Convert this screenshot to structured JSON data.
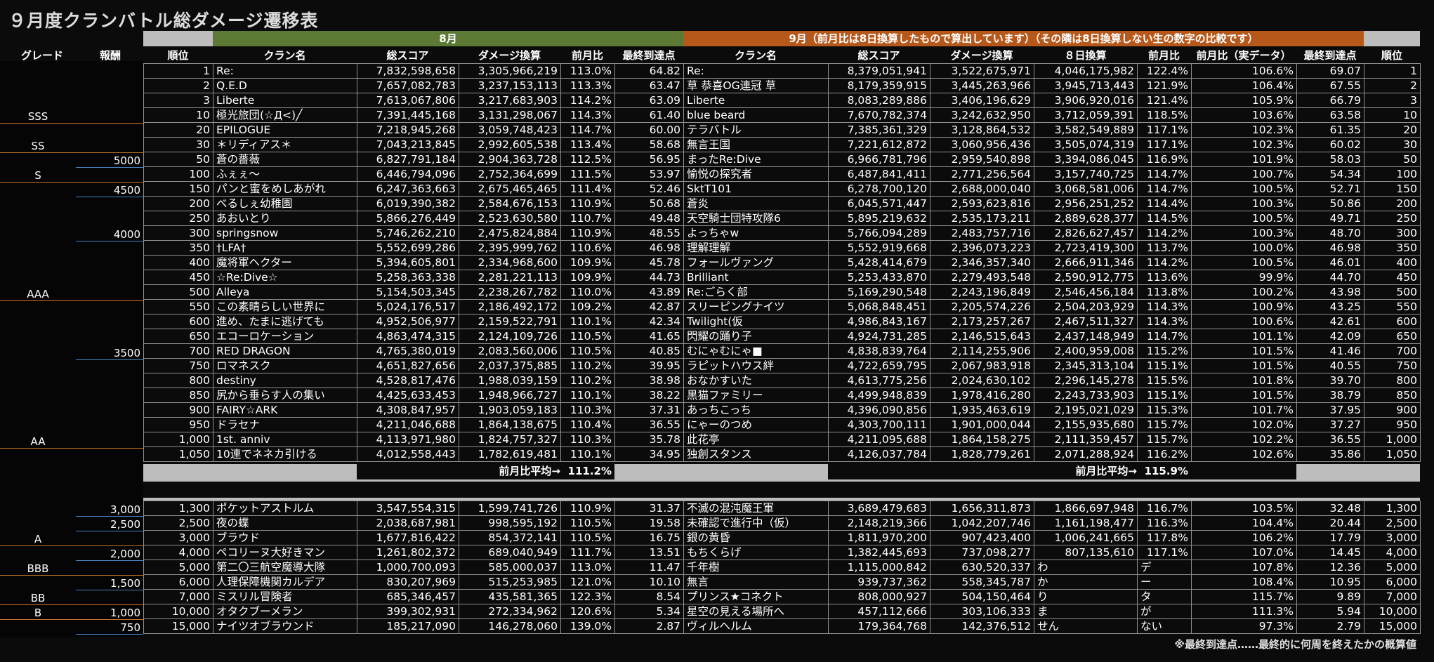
{
  "title": "９月度クランバトル総ダメージ遷移表",
  "headers": {
    "aug_band": "8月",
    "sep_band": "9月（前月比は8日換算したもので算出しています）（その隣は8日換算しない生の数字の比較です）",
    "grade": "グレード",
    "reward": "報酬",
    "rank": "順位",
    "clan": "クラン名",
    "total": "総スコア",
    "dmg": "ダメージ換算",
    "mom": "前月比",
    "final": "最終到達点",
    "clan2": "クラン名",
    "total2": "総スコア",
    "dmg2": "ダメージ換算",
    "eight": "８日換算",
    "mom2": "前月比",
    "momreal": "前月比（実データ）",
    "final2": "最終到達点",
    "rank2": "順位"
  },
  "avg": {
    "aug_label": "前月比平均→",
    "aug_value": "111.2%",
    "sep_label": "前月比平均→",
    "sep_value": "115.9%"
  },
  "grades": [
    {
      "label": "SSS"
    },
    {
      "label": "SS"
    },
    {
      "label": "S"
    },
    {
      "label": "AAA"
    },
    {
      "label": "AA"
    },
    {
      "label": "A"
    },
    {
      "label": "BBB"
    },
    {
      "label": "BB"
    },
    {
      "label": "B"
    }
  ],
  "rewards": [
    {
      "label": "5000"
    },
    {
      "label": "4500"
    },
    {
      "label": "4000"
    },
    {
      "label": "3500"
    },
    {
      "label": "3,000"
    },
    {
      "label": "2,500"
    },
    {
      "label": "2,000"
    },
    {
      "label": "1,500"
    },
    {
      "label": "1,000"
    },
    {
      "label": "750"
    }
  ],
  "rows_top": [
    [
      "1",
      "Re:",
      "7,832,598,658",
      "3,305,966,219",
      "113.0%",
      "64.82",
      "Re:",
      "8,379,051,941",
      "3,522,675,971",
      "4,046,175,982",
      "122.4%",
      "106.6%",
      "69.07",
      "1"
    ],
    [
      "2",
      "Q.E.D",
      "7,657,082,783",
      "3,237,153,113",
      "113.3%",
      "63.47",
      "草 恭喜OG連冠 草",
      "8,179,359,915",
      "3,445,263,966",
      "3,945,713,443",
      "121.9%",
      "106.4%",
      "67.55",
      "2"
    ],
    [
      "3",
      "Liberte",
      "7,613,067,806",
      "3,217,683,903",
      "114.2%",
      "63.09",
      "Liberte",
      "8,083,289,886",
      "3,406,196,629",
      "3,906,920,016",
      "121.4%",
      "105.9%",
      "66.79",
      "3"
    ],
    [
      "10",
      "極光旅団(☆Д<)╱",
      "7,391,445,168",
      "3,131,298,067",
      "114.3%",
      "61.40",
      "blue beard",
      "7,670,782,374",
      "3,242,632,950",
      "3,712,059,391",
      "118.5%",
      "103.6%",
      "63.58",
      "10"
    ],
    [
      "20",
      "EPILOGUE",
      "7,218,945,268",
      "3,059,748,423",
      "114.7%",
      "60.00",
      "テラバトル",
      "7,385,361,329",
      "3,128,864,532",
      "3,582,549,889",
      "117.1%",
      "102.3%",
      "61.35",
      "20"
    ],
    [
      "30",
      "＊リディアス＊",
      "7,043,213,845",
      "2,992,605,538",
      "113.4%",
      "58.68",
      "無言王国",
      "7,221,612,872",
      "3,060,956,436",
      "3,505,074,319",
      "117.1%",
      "102.3%",
      "60.02",
      "30"
    ],
    [
      "50",
      "蒼の薔薇",
      "6,827,791,184",
      "2,904,363,728",
      "112.5%",
      "56.95",
      "まったRe:Dive",
      "6,966,781,796",
      "2,959,540,898",
      "3,394,086,045",
      "116.9%",
      "101.9%",
      "58.03",
      "50"
    ],
    [
      "100",
      "ふぇぇ～",
      "6,446,794,096",
      "2,752,364,699",
      "111.5%",
      "53.97",
      "愉悦の探究者",
      "6,487,841,411",
      "2,771,256,564",
      "3,157,740,725",
      "114.7%",
      "100.7%",
      "54.34",
      "100"
    ],
    [
      "150",
      "パンと蜜をめしあがれ",
      "6,247,363,663",
      "2,675,465,465",
      "111.4%",
      "52.46",
      "SktT101",
      "6,278,700,120",
      "2,688,000,040",
      "3,068,581,006",
      "114.7%",
      "100.5%",
      "52.71",
      "150"
    ],
    [
      "200",
      "べるしぇ幼稚園",
      "6,019,390,382",
      "2,584,676,153",
      "110.9%",
      "50.68",
      "蒼炎",
      "6,045,571,447",
      "2,593,623,816",
      "2,956,251,252",
      "114.4%",
      "100.3%",
      "50.86",
      "200"
    ],
    [
      "250",
      "あおいとり",
      "5,866,276,449",
      "2,523,630,580",
      "110.7%",
      "49.48",
      "天空騎士団特攻隊6",
      "5,895,219,632",
      "2,535,173,211",
      "2,889,628,377",
      "114.5%",
      "100.5%",
      "49.71",
      "250"
    ],
    [
      "300",
      "springsnow",
      "5,746,262,210",
      "2,475,824,884",
      "110.9%",
      "48.55",
      "よっちゃw",
      "5,766,094,289",
      "2,483,757,716",
      "2,826,627,457",
      "114.2%",
      "100.3%",
      "48.70",
      "300"
    ],
    [
      "350",
      "†LFA†",
      "5,552,699,286",
      "2,395,999,762",
      "110.6%",
      "46.98",
      "理解理解",
      "5,552,919,668",
      "2,396,073,223",
      "2,723,419,300",
      "113.7%",
      "100.0%",
      "46.98",
      "350"
    ],
    [
      "400",
      "魔将軍ヘクター",
      "5,394,605,801",
      "2,334,968,600",
      "109.9%",
      "45.78",
      "フォールヴァング",
      "5,428,414,679",
      "2,346,357,340",
      "2,666,911,346",
      "114.2%",
      "100.5%",
      "46.01",
      "400"
    ],
    [
      "450",
      "☆Re:Dive☆",
      "5,258,363,338",
      "2,281,221,113",
      "109.9%",
      "44.73",
      "Brilliant",
      "5,253,433,870",
      "2,279,493,548",
      "2,590,912,775",
      "113.6%",
      "99.9%",
      "44.70",
      "450"
    ],
    [
      "500",
      "Alleya",
      "5,154,503,345",
      "2,238,267,782",
      "110.0%",
      "43.89",
      "Re:ごらく部",
      "5,169,290,548",
      "2,243,196,849",
      "2,546,456,184",
      "113.8%",
      "100.2%",
      "43.98",
      "500"
    ],
    [
      "550",
      "この素晴らしい世界に",
      "5,024,176,517",
      "2,186,492,172",
      "109.2%",
      "42.87",
      "スリーピングナイツ",
      "5,068,848,451",
      "2,205,574,226",
      "2,504,203,929",
      "114.3%",
      "100.9%",
      "43.25",
      "550"
    ],
    [
      "600",
      "進め、たまに逃げても",
      "4,952,506,977",
      "2,159,522,791",
      "110.1%",
      "42.34",
      "Twilight(仮",
      "4,986,843,167",
      "2,173,257,267",
      "2,467,511,327",
      "114.3%",
      "100.6%",
      "42.61",
      "600"
    ],
    [
      "650",
      "エコーロケーション",
      "4,863,474,315",
      "2,124,109,726",
      "110.5%",
      "41.65",
      "閃耀の踊り子",
      "4,924,731,285",
      "2,146,515,643",
      "2,437,148,949",
      "114.7%",
      "101.1%",
      "42.09",
      "650"
    ],
    [
      "700",
      "RED DRAGON",
      "4,765,380,019",
      "2,083,560,006",
      "110.5%",
      "40.85",
      "むにゃむにゃ■",
      "4,838,839,764",
      "2,114,255,906",
      "2,400,959,008",
      "115.2%",
      "101.5%",
      "41.46",
      "700"
    ],
    [
      "750",
      "ロマネスク",
      "4,651,827,656",
      "2,037,375,885",
      "110.2%",
      "39.95",
      "ラピットハウス絆",
      "4,722,659,795",
      "2,067,983,918",
      "2,345,313,104",
      "115.1%",
      "101.5%",
      "40.55",
      "750"
    ],
    [
      "800",
      "destiny",
      "4,528,817,476",
      "1,988,039,159",
      "110.2%",
      "38.98",
      "おなかすいた",
      "4,613,775,256",
      "2,024,630,102",
      "2,296,145,278",
      "115.5%",
      "101.8%",
      "39.70",
      "800"
    ],
    [
      "850",
      "尻から垂らす人の集い",
      "4,425,633,453",
      "1,948,966,727",
      "110.1%",
      "38.22",
      "黒猫ファミリー",
      "4,499,948,839",
      "1,978,416,280",
      "2,243,733,903",
      "115.1%",
      "101.5%",
      "38.79",
      "850"
    ],
    [
      "900",
      "FAIRY☆ARK",
      "4,308,847,957",
      "1,903,059,183",
      "110.3%",
      "37.31",
      "あっちこっち",
      "4,396,090,856",
      "1,935,463,619",
      "2,195,021,029",
      "115.3%",
      "101.7%",
      "37.95",
      "900"
    ],
    [
      "950",
      "ドラセナ",
      "4,211,046,688",
      "1,864,138,675",
      "110.4%",
      "36.55",
      "にゃーのつめ",
      "4,303,700,111",
      "1,901,000,044",
      "2,155,935,680",
      "115.7%",
      "102.0%",
      "37.27",
      "950"
    ],
    [
      "1,000",
      "1st. anniv",
      "4,113,971,980",
      "1,824,757,327",
      "110.3%",
      "35.78",
      "此花亭",
      "4,211,095,688",
      "1,864,158,275",
      "2,111,359,457",
      "115.7%",
      "102.2%",
      "36.55",
      "1,000"
    ],
    [
      "1,050",
      "10連でネネカ引ける",
      "4,012,558,443",
      "1,782,619,481",
      "110.1%",
      "34.95",
      "独創スタンス",
      "4,126,037,784",
      "1,828,779,261",
      "2,071,288,924",
      "116.2%",
      "102.6%",
      "35.86",
      "1,050"
    ]
  ],
  "rows_bottom": [
    [
      "1,300",
      "ポケットアストルム",
      "3,547,554,315",
      "1,599,741,726",
      "110.9%",
      "31.37",
      "不滅の混沌魔王軍",
      "3,689,479,683",
      "1,656,311,873",
      "1,866,697,948",
      "116.7%",
      "103.5%",
      "32.48",
      "1,300"
    ],
    [
      "2,500",
      "夜の蝶",
      "2,038,687,981",
      "998,595,192",
      "110.5%",
      "19.58",
      "未確認で進行中（仮）",
      "2,148,219,366",
      "1,042,207,746",
      "1,161,198,477",
      "116.3%",
      "104.4%",
      "20.44",
      "2,500"
    ],
    [
      "3,000",
      "ブラウド",
      "1,677,816,422",
      "854,372,141",
      "110.5%",
      "16.75",
      "銀の黄昏",
      "1,811,970,200",
      "907,423,400",
      "1,006,241,665",
      "117.8%",
      "106.2%",
      "17.79",
      "3,000"
    ],
    [
      "4,000",
      "ペコリーヌ大好きマン",
      "1,261,802,372",
      "689,040,949",
      "111.7%",
      "13.51",
      "もちくらげ",
      "1,382,445,693",
      "737,098,277",
      "807,135,610",
      "117.1%",
      "107.0%",
      "14.45",
      "4,000"
    ],
    [
      "5,000",
      "第二〇三航空魔導大隊",
      "1,000,700,093",
      "585,000,037",
      "113.0%",
      "11.47",
      "千年樹",
      "1,115,000,842",
      "630,520,337",
      "わ",
      "デ",
      "107.8%",
      "12.36",
      "5,000"
    ],
    [
      "6,000",
      "人理保障機関カルデア",
      "830,207,969",
      "515,253,985",
      "121.0%",
      "10.10",
      "無言",
      "939,737,362",
      "558,345,787",
      "か",
      "ー",
      "108.4%",
      "10.95",
      "6,000"
    ],
    [
      "7,000",
      "ミスリル冒険者",
      "685,346,457",
      "435,581,365",
      "122.3%",
      "8.54",
      "プリンス★コネクト",
      "808,000,927",
      "504,150,464",
      "り",
      "タ",
      "115.7%",
      "9.89",
      "7,000"
    ],
    [
      "10,000",
      "オタクブーメラン",
      "399,302,931",
      "272,334,962",
      "120.6%",
      "5.34",
      "星空の見える場所へ",
      "457,112,666",
      "303,106,333",
      "ま",
      "が",
      "111.3%",
      "5.94",
      "10,000"
    ],
    [
      "15,000",
      "ナイツオブラウンド",
      "185,217,090",
      "146,278,060",
      "139.0%",
      "2.87",
      "ヴィルヘルム",
      "179,364,768",
      "142,376,512",
      "せん",
      "ない",
      "97.3%",
      "2.79",
      "15,000"
    ]
  ],
  "footnote": "※最終到達点……最終的に何周を終えたかの概算値"
}
